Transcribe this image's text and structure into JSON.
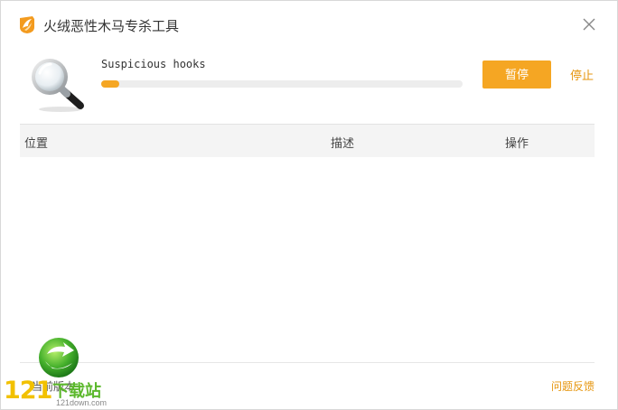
{
  "window": {
    "title": "火绒恶性木马专杀工具",
    "close_icon": "close-icon"
  },
  "scan": {
    "status_text": "Suspicious hooks",
    "progress_fraction": 0.05,
    "pause_label": "暂停",
    "stop_label": "停止"
  },
  "table": {
    "columns": [
      "位置",
      "描述",
      "操作"
    ],
    "rows": []
  },
  "footer": {
    "version_text": "当前版本",
    "feedback_label": "问题反馈"
  },
  "watermark": {
    "number": "121",
    "text": "下载站",
    "url": "121down.com"
  },
  "colors": {
    "accent": "#f5a623",
    "link": "#e6960f",
    "header_bg": "#f4f4f4",
    "progress_track": "#ededed"
  }
}
